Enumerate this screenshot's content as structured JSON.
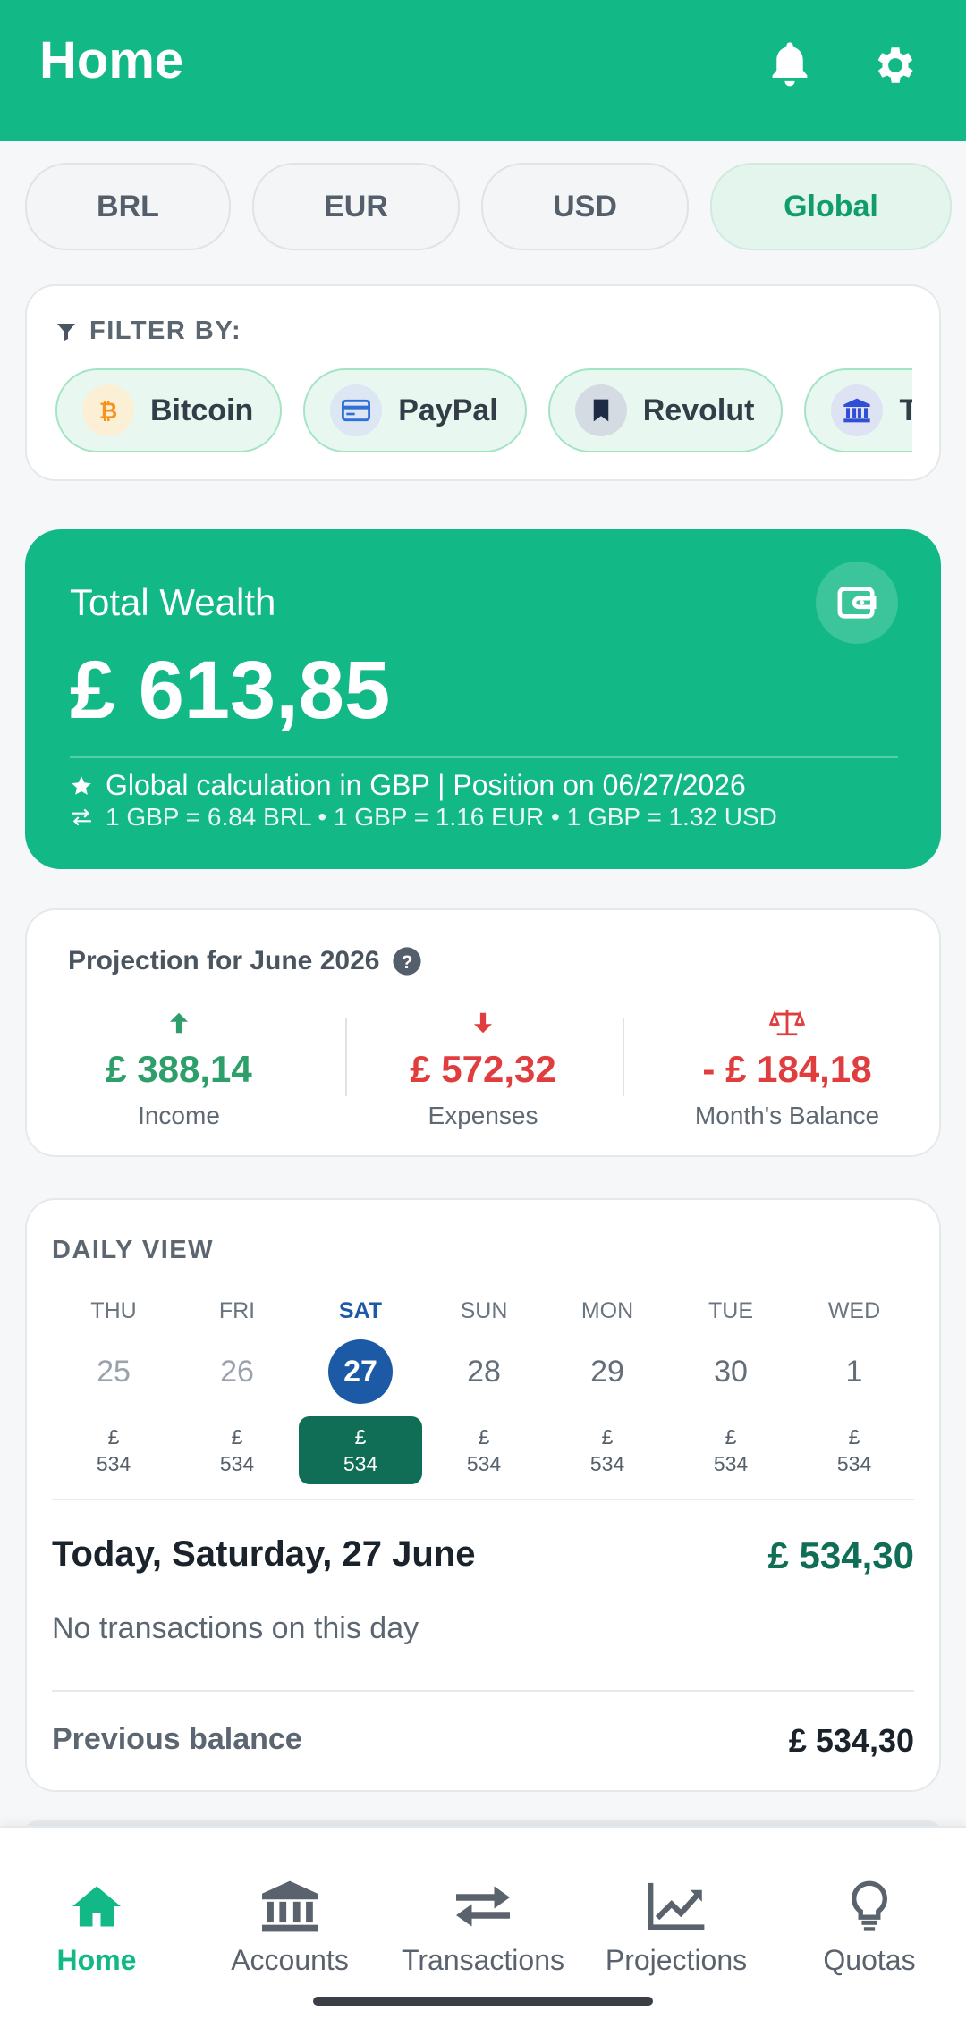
{
  "header": {
    "title": "Home",
    "icons": [
      "bell-icon",
      "gear-icon"
    ]
  },
  "currency_tabs": [
    {
      "label": "BRL",
      "active": false
    },
    {
      "label": "EUR",
      "active": false
    },
    {
      "label": "USD",
      "active": false
    },
    {
      "label": "Global",
      "active": true
    }
  ],
  "filter": {
    "heading": "FILTER BY:",
    "chips": [
      {
        "label": "Bitcoin",
        "icon": "bitcoin-icon",
        "color": "#f7931a"
      },
      {
        "label": "PayPal",
        "icon": "card-icon",
        "color": "#2f6fd6"
      },
      {
        "label": "Revolut",
        "icon": "bookmark-icon",
        "color": "#1f2a44"
      },
      {
        "label": "Tes",
        "icon": "bank-icon",
        "color": "#2f4fd6"
      }
    ]
  },
  "wealth": {
    "label": "Total Wealth",
    "amount": "£ 613,85",
    "note": "Global calculation in GBP | Position on 06/27/2026",
    "rates": "1 GBP = 6.84 BRL • 1 GBP = 1.16 EUR • 1 GBP = 1.32 USD"
  },
  "projection": {
    "title": "Projection for June 2026",
    "income": {
      "value": "£ 388,14",
      "label": "Income",
      "color": "#2e9e6a"
    },
    "expenses": {
      "value": "£ 572,32",
      "label": "Expenses",
      "color": "#e03e3e"
    },
    "balance": {
      "value": "- £ 184,18",
      "label": "Month's Balance",
      "color": "#e03e3e"
    }
  },
  "daily": {
    "title": "DAILY VIEW",
    "days": [
      {
        "name": "THU",
        "num": "25",
        "currency": "£",
        "amount": "534",
        "state": "past"
      },
      {
        "name": "FRI",
        "num": "26",
        "currency": "£",
        "amount": "534",
        "state": "past"
      },
      {
        "name": "SAT",
        "num": "27",
        "currency": "£",
        "amount": "534",
        "state": "selected"
      },
      {
        "name": "SUN",
        "num": "28",
        "currency": "£",
        "amount": "534",
        "state": "future"
      },
      {
        "name": "MON",
        "num": "29",
        "currency": "£",
        "amount": "534",
        "state": "future"
      },
      {
        "name": "TUE",
        "num": "30",
        "currency": "£",
        "amount": "534",
        "state": "future"
      },
      {
        "name": "WED",
        "num": "1",
        "currency": "£",
        "amount": "534",
        "state": "future"
      }
    ],
    "today_title": "Today, Saturday, 27 June",
    "today_amount": "£ 534,30",
    "empty_text": "No transactions on this day",
    "prev_label": "Previous balance",
    "prev_amount": "£ 534,30"
  },
  "nav": [
    {
      "label": "Home",
      "icon": "home-icon",
      "active": true
    },
    {
      "label": "Accounts",
      "icon": "bank-icon",
      "active": false
    },
    {
      "label": "Transactions",
      "icon": "transfer-arrows-icon",
      "active": false
    },
    {
      "label": "Projections",
      "icon": "trend-chart-icon",
      "active": false
    },
    {
      "label": "Quotas",
      "icon": "lightbulb-icon",
      "active": false
    }
  ],
  "colors": {
    "primary": "#12b886",
    "selected_day": "#1c5aa6",
    "dark_green": "#0f6e55"
  }
}
